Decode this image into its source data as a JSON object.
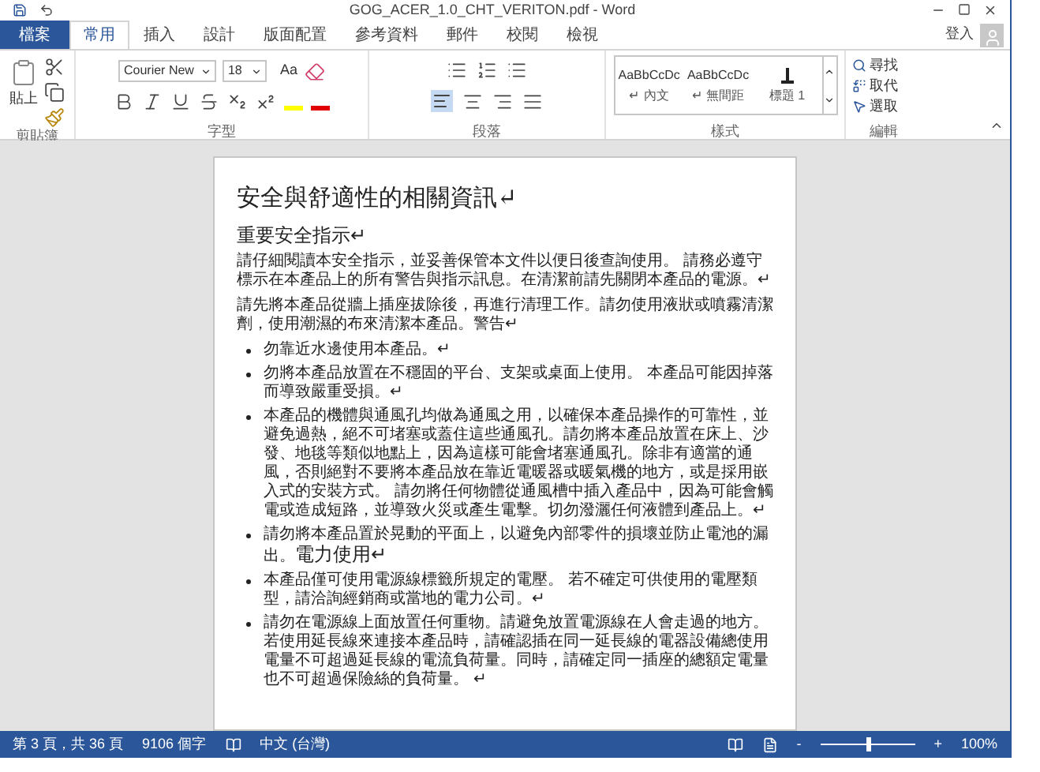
{
  "title_bar": {
    "title": "GOG_ACER_1.0_CHT_VERITON.pdf - Word"
  },
  "tabs": [
    {
      "label": "檔案",
      "kind": "file",
      "selected": false
    },
    {
      "label": "常用",
      "kind": "tab",
      "selected": true
    },
    {
      "label": "插入",
      "kind": "tab",
      "selected": false
    },
    {
      "label": "設計",
      "kind": "tab",
      "selected": false
    },
    {
      "label": "版面配置",
      "kind": "tab",
      "selected": false
    },
    {
      "label": "參考資料",
      "kind": "tab",
      "selected": false
    },
    {
      "label": "郵件",
      "kind": "tab",
      "selected": false
    },
    {
      "label": "校閱",
      "kind": "tab",
      "selected": false
    },
    {
      "label": "檢視",
      "kind": "tab",
      "selected": false
    }
  ],
  "account": {
    "label": "登入"
  },
  "ribbon": {
    "clipboard": {
      "paste_label": "貼上",
      "group_label": "剪貼簿"
    },
    "font": {
      "font_name": "Courier New",
      "font_size": "18",
      "change_case": "Aa",
      "group_label": "字型"
    },
    "paragraph": {
      "group_label": "段落"
    },
    "styles": {
      "items": [
        {
          "preview": "AaBbCcDc",
          "label": "↵ 內文"
        },
        {
          "preview": "AaBbCcDc",
          "label": "↵ 無間距"
        },
        {
          "label": "標題 1"
        }
      ],
      "group_label": "樣式"
    },
    "editing": {
      "items": [
        {
          "label": "尋找",
          "kind": "find"
        },
        {
          "label": "取代",
          "kind": "replace"
        },
        {
          "label": "選取",
          "kind": "select"
        }
      ],
      "group_label": "編輯"
    }
  },
  "document": {
    "title": "安全與舒適性的相關資訊↵",
    "heading": "重要安全指示↵",
    "paragraphs": [
      "請仔細閱讀本安全指示，並妥善保管本文件以便日後查詢使用。 請務必遵守標示在本產品上的所有警告與指示訊息。在清潔前請先關閉本產品的電源。↵",
      "請先將本產品從牆上插座拔除後，再進行清理工作。請勿使用液狀或噴霧清潔劑，使用潮濕的布來清潔本產品。警告↵"
    ],
    "bullets": [
      {
        "text": "勿靠近水邊使用本產品。↵"
      },
      {
        "text": "勿將本產品放置在不穩固的平台、支架或桌面上使用。 本產品可能因掉落而導致嚴重受損。↵"
      },
      {
        "text": "本產品的機體與通風孔均做為通風之用，以確保本產品操作的可靠性，並避免過熱，絕不可堵塞或蓋住這些通風孔。請勿將本產品放置在床上、沙發、地毯等類似地點上，因為這樣可能會堵塞通風孔。除非有適當的通風，否則絕對不要將本產品放在靠近電暖器或暖氣機的地方，或是採用嵌入式的安裝方式。 請勿將任何物體從通風槽中插入產品中，因為可能會觸電或造成短路，並導致火災或產生電擊。切勿潑灑任何液體到產品上。↵"
      },
      {
        "text": "請勿將本產品置於晃動的平面上，以避免內部零件的損壞並防止電池的漏出。",
        "heading": "電力使用↵"
      },
      {
        "text": "本產品僅可使用電源線標籤所規定的電壓。 若不確定可供使用的電壓類型，請洽詢經銷商或當地的電力公司。↵"
      },
      {
        "text": "請勿在電源線上面放置任何重物。請避免放置電源線在人會走過的地方。若使用延長線來連接本產品時，請確認插在同一延長線的電器設備總使用電量不可超過延長線的電流負荷量。同時，請確定同一插座的總額定電量也不可超過保險絲的負荷量。 ↵"
      }
    ]
  },
  "status_bar": {
    "page": "第 3 頁，共 36 頁",
    "words": "9106 個字",
    "language": "中文 (台灣)",
    "zoom_minus": "-",
    "zoom_plus": "+",
    "zoom": "100%",
    "zoom_slider": {
      "level": 0.5
    }
  }
}
